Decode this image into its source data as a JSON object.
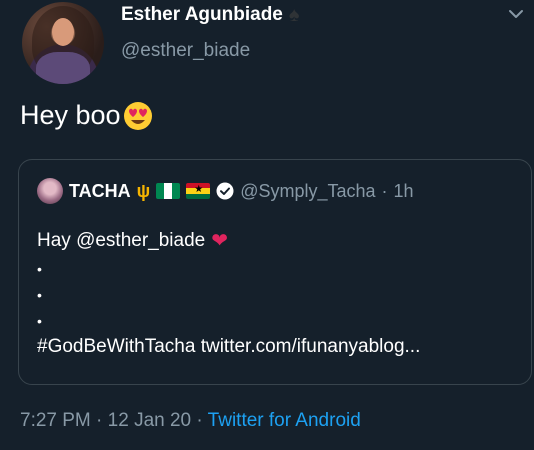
{
  "tweet": {
    "author_name": "Esther Agunbiade",
    "author_handle": "@esther_biade",
    "text": "Hey boo",
    "time": "7:27 PM",
    "sep1": "·",
    "date": "12 Jan 20",
    "sep2": "·",
    "source": "Twitter for Android"
  },
  "quoted": {
    "author_name": "TACHA",
    "author_handle": "@Symply_Tacha",
    "sep": "·",
    "time": "1h",
    "line1": "Hay @esther_biade",
    "dot": "•",
    "last_line": "#GodBeWithTacha twitter.com/ifunanyablog..."
  },
  "colors": {
    "background": "#15202b",
    "secondary_text": "#8899a6",
    "link": "#1da1f2",
    "border": "#38444d"
  },
  "icons": [
    "spade-icon",
    "chevron-down-icon",
    "heart-eyes-emoji",
    "trident-icon",
    "nigeria-flag",
    "ghana-flag",
    "verified-icon",
    "red-heart-icon"
  ]
}
